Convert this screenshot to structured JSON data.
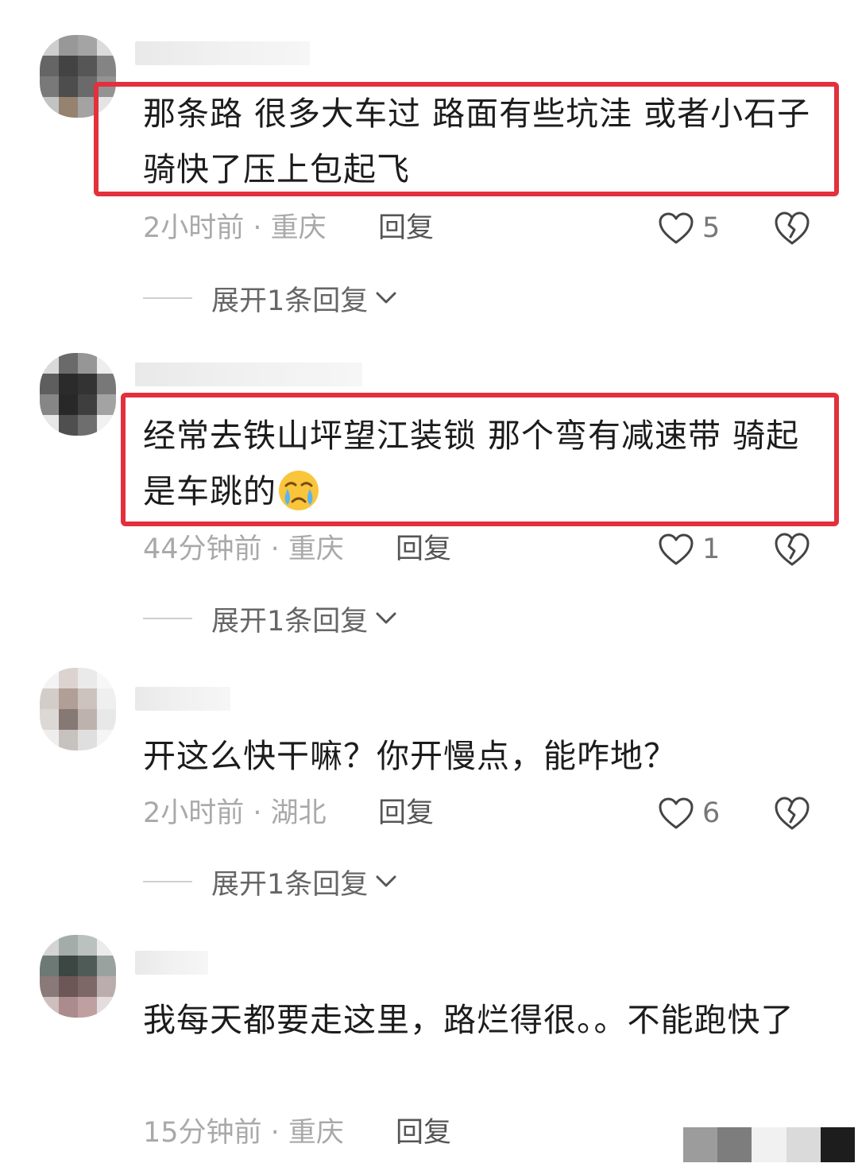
{
  "comments": [
    {
      "text": "那条路 很多大车过 路面有些坑洼 或者小石子 骑快了压上包起飞",
      "time_location": "2小时前 · 重庆",
      "reply_label": "回复",
      "likes": "5",
      "expand_label": "展开1条回复",
      "highlighted": true
    },
    {
      "text": "经常去铁山坪望江装锁  那个弯有减速带 骑起是车跳的",
      "time_location": "44分钟前 · 重庆",
      "reply_label": "回复",
      "likes": "1",
      "expand_label": "展开1条回复",
      "highlighted": true,
      "emoji": "crying-face-emoji"
    },
    {
      "text": "开这么快干嘛？你开慢点，能咋地？",
      "time_location": "2小时前 · 湖北",
      "reply_label": "回复",
      "likes": "6",
      "expand_label": "展开1条回复",
      "highlighted": false
    },
    {
      "text": "我每天都要走这里，路烂得很。。不能跑快了",
      "time_location": "15分钟前 · 重庆",
      "reply_label": "回复",
      "highlighted": false
    }
  ],
  "colors": {
    "highlight_border": "#e2303d",
    "meta_text": "#a9a9a9",
    "body_text": "#1c1c1c"
  },
  "icons": {
    "like": "heart-outline-icon",
    "dislike": "broken-heart-icon",
    "expand": "chevron-down-icon"
  }
}
